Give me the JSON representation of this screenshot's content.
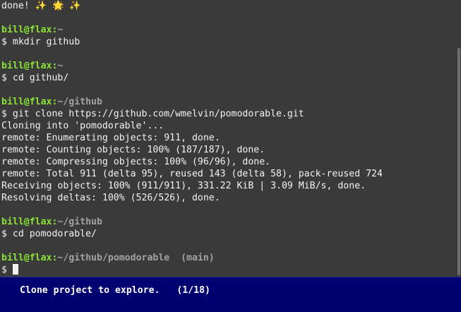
{
  "terminal": {
    "prompt_user": "bill@flax",
    "lines": [
      {
        "type": "output",
        "text": "done! ✨ 🌟 ✨"
      },
      {
        "type": "blank"
      },
      {
        "type": "prompt",
        "path": "~",
        "branch": ""
      },
      {
        "type": "command",
        "text": "$ mkdir github"
      },
      {
        "type": "blank"
      },
      {
        "type": "prompt",
        "path": "~",
        "branch": ""
      },
      {
        "type": "command",
        "text": "$ cd github/"
      },
      {
        "type": "blank"
      },
      {
        "type": "prompt",
        "path": "~/github",
        "branch": ""
      },
      {
        "type": "command",
        "text": "$ git clone https://github.com/wmelvin/pomodorable.git"
      },
      {
        "type": "output",
        "text": "Cloning into 'pomodorable'..."
      },
      {
        "type": "output",
        "text": "remote: Enumerating objects: 911, done."
      },
      {
        "type": "output",
        "text": "remote: Counting objects: 100% (187/187), done."
      },
      {
        "type": "output",
        "text": "remote: Compressing objects: 100% (96/96), done."
      },
      {
        "type": "output",
        "text": "remote: Total 911 (delta 95), reused 143 (delta 58), pack-reused 724"
      },
      {
        "type": "output",
        "text": "Receiving objects: 100% (911/911), 331.22 KiB | 3.09 MiB/s, done."
      },
      {
        "type": "output",
        "text": "Resolving deltas: 100% (526/526), done."
      },
      {
        "type": "blank"
      },
      {
        "type": "prompt",
        "path": "~/github",
        "branch": ""
      },
      {
        "type": "command",
        "text": "$ cd pomodorable/"
      },
      {
        "type": "blank"
      },
      {
        "type": "prompt",
        "path": "~/github/pomodorable",
        "branch": "  (main)"
      },
      {
        "type": "input",
        "text": "$ "
      }
    ]
  },
  "statusbar": {
    "message": "Clone project to explore.",
    "progress": "(1/18)"
  }
}
